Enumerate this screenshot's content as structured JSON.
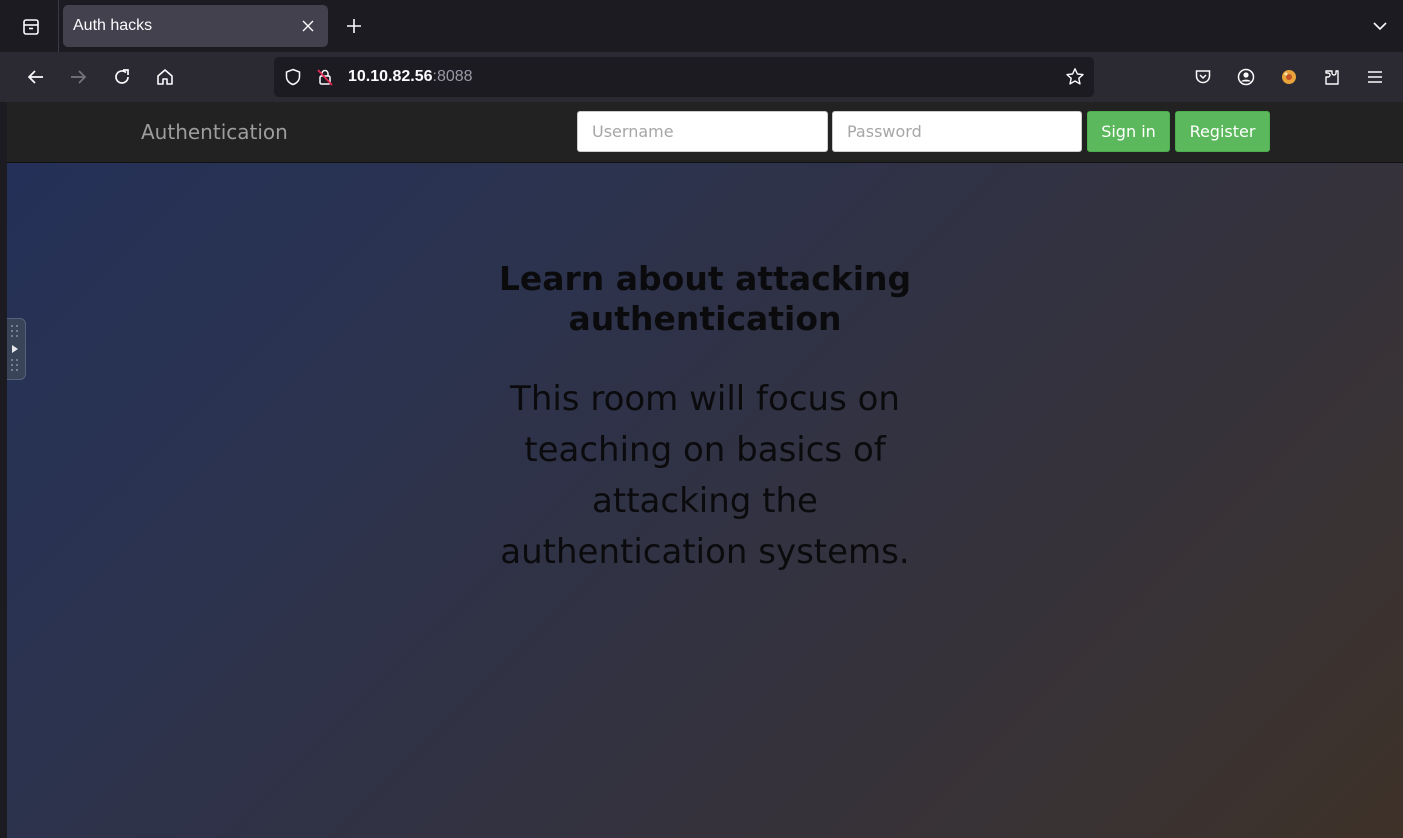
{
  "browser": {
    "tab": {
      "title": "Auth hacks"
    },
    "url": {
      "host": "10.10.82.56",
      "port": ":8088"
    },
    "icons": {
      "tab_list": "tab-list-icon",
      "close": "close-icon",
      "new_tab": "plus-icon",
      "list_all_tabs": "chevron-down-icon",
      "back": "back-arrow-icon",
      "forward": "forward-arrow-icon",
      "reload": "reload-icon",
      "home": "home-icon",
      "tracking_protection": "shield-icon",
      "insecure": "insecure-lock-icon",
      "bookmark": "star-icon",
      "pocket": "pocket-icon",
      "account": "account-icon",
      "extension": "extension-icon",
      "extensions_menu": "puzzle-icon",
      "menu": "hamburger-menu-icon"
    }
  },
  "site": {
    "brand": "Authentication",
    "login": {
      "username_placeholder": "Username",
      "password_placeholder": "Password",
      "signin_label": "Sign in",
      "register_label": "Register"
    },
    "hero": {
      "title_lines": [
        "Learn about attacking",
        "authentication"
      ],
      "text_lines": [
        "This room will focus on",
        "teaching on basics of",
        "attacking the",
        "authentication systems."
      ]
    }
  },
  "colors": {
    "accent_green": "#5cb85c",
    "header_bg": "#222222",
    "browser_bg": "#1c1b22"
  }
}
